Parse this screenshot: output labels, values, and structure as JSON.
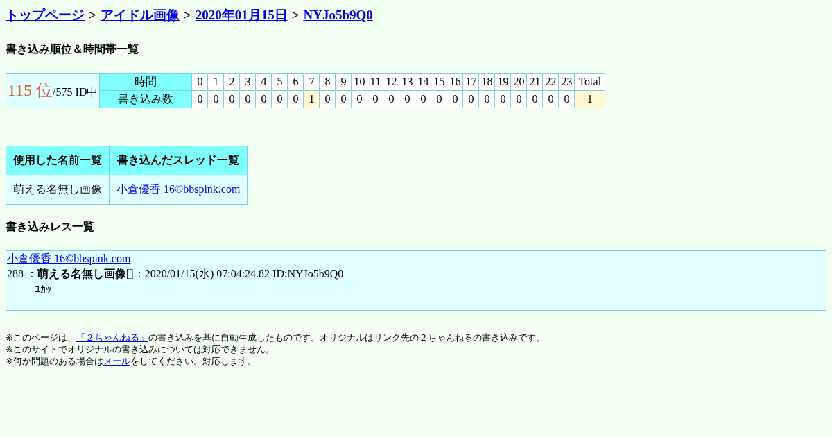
{
  "breadcrumb": [
    {
      "label": "トップページ"
    },
    {
      "label": "アイドル画像"
    },
    {
      "label": "2020年01月15日"
    },
    {
      "label": "NYJo5b9Q0"
    }
  ],
  "separator": ">",
  "rank_heading": "書き込み順位＆時間帯一覧",
  "rank": {
    "position": "115 位",
    "total": "/575 ID中"
  },
  "hours_label": "時間",
  "counts_label": "書き込み数",
  "hours": [
    "0",
    "1",
    "2",
    "3",
    "4",
    "5",
    "6",
    "7",
    "8",
    "9",
    "10",
    "11",
    "12",
    "13",
    "14",
    "15",
    "16",
    "17",
    "18",
    "19",
    "20",
    "21",
    "22",
    "23",
    "Total"
  ],
  "counts": [
    {
      "value": "0",
      "highlighted": false
    },
    {
      "value": "0",
      "highlighted": false
    },
    {
      "value": "0",
      "highlighted": false
    },
    {
      "value": "0",
      "highlighted": false
    },
    {
      "value": "0",
      "highlighted": false
    },
    {
      "value": "0",
      "highlighted": false
    },
    {
      "value": "0",
      "highlighted": false
    },
    {
      "value": "1",
      "highlighted": true
    },
    {
      "value": "0",
      "highlighted": false
    },
    {
      "value": "0",
      "highlighted": false
    },
    {
      "value": "0",
      "highlighted": false
    },
    {
      "value": "0",
      "highlighted": false
    },
    {
      "value": "0",
      "highlighted": false
    },
    {
      "value": "0",
      "highlighted": false
    },
    {
      "value": "0",
      "highlighted": false
    },
    {
      "value": "0",
      "highlighted": false
    },
    {
      "value": "0",
      "highlighted": false
    },
    {
      "value": "0",
      "highlighted": false
    },
    {
      "value": "0",
      "highlighted": false
    },
    {
      "value": "0",
      "highlighted": false
    },
    {
      "value": "0",
      "highlighted": false
    },
    {
      "value": "0",
      "highlighted": false
    },
    {
      "value": "0",
      "highlighted": false
    },
    {
      "value": "0",
      "highlighted": false
    },
    {
      "value": "1",
      "highlighted": true
    }
  ],
  "names_table": {
    "columns": [
      "使用した名前一覧",
      "書き込んだスレッド一覧"
    ],
    "name": "萌える名無し画像",
    "thread": "小倉優香 16©bbspink.com"
  },
  "posts_heading": "書き込みレス一覧",
  "post": {
    "thread": "小倉優香 16©bbspink.com",
    "header": "288 ：**萌える名無し画像**[]：2020/01/15(水) 07:04:24.82 ID:NYJo5b9Q0",
    "body": "ﾕｶｯ"
  },
  "footer": [
    {
      "before": "※このページは、",
      "link": "「２ちゃんねる」",
      "after": "の書き込みを基に自動生成したものです。オリジナルはリンク先の２ちゃんねるの書き込みです。"
    },
    {
      "before": "※このサイトでオリジナルの書き込みについては対応できません。"
    },
    {
      "before": "※何か問題のある場合は",
      "link": "メール",
      "after": "をしてください。対応します。"
    }
  ]
}
